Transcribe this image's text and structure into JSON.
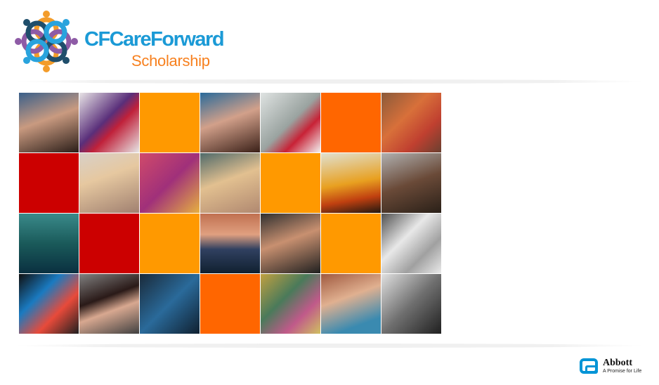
{
  "header": {
    "brand_line1": "CFCareForward",
    "brand_line2": "Scholarship"
  },
  "colors": {
    "brand_blue": "#1b9ad6",
    "brand_orange": "#f7801e",
    "tile_orange": "#ff9900",
    "tile_dark_orange": "#ff6600",
    "tile_red": "#cc0000"
  },
  "tiles": [
    {
      "kind": "photo",
      "subject": "student-portrait",
      "bg": "linear-gradient(160deg,#3a5f8a,#c99a80 45%,#2a1d18)"
    },
    {
      "kind": "art",
      "subject": "rose-painting",
      "bg": "linear-gradient(135deg,#e8e4e6,#5a2f7a 45%,#c0213a 60%,#e6e6e6)"
    },
    {
      "kind": "solid",
      "bg": "#ff9900"
    },
    {
      "kind": "photo",
      "subject": "student-portrait",
      "bg": "linear-gradient(160deg,#2a6a9a,#d2a08a 45%,#3a2018)"
    },
    {
      "kind": "art",
      "subject": "lighthouse-poem",
      "bg": "linear-gradient(135deg,#dfe3e2,#9aa3a0 50%,#c82236 70%,#f2f2f2)"
    },
    {
      "kind": "solid",
      "bg": "#ff6600"
    },
    {
      "kind": "art",
      "subject": "tree-painting",
      "bg": "linear-gradient(135deg,#8a5a3a,#d8703a 40%,#c04030 70%,#6a4030)"
    },
    {
      "kind": "solid",
      "bg": "#cc0000"
    },
    {
      "kind": "photo",
      "subject": "student-portrait",
      "bg": "linear-gradient(160deg,#d8d0c8,#e6c8a0 40%,#a08070)"
    },
    {
      "kind": "art",
      "subject": "collage-painting",
      "bg": "linear-gradient(135deg,#d04a6a,#a0307a 50%,#e6b040)"
    },
    {
      "kind": "photo",
      "subject": "student-portrait",
      "bg": "linear-gradient(160deg,#506a6a,#e2c090 45%,#b08870)"
    },
    {
      "kind": "solid",
      "bg": "#ff9900"
    },
    {
      "kind": "art",
      "subject": "sunset-silhouette",
      "bg": "linear-gradient(170deg,#e0e0d0,#e8a020 50%,#c04010 75%,#201810)"
    },
    {
      "kind": "photo",
      "subject": "student-portrait",
      "bg": "linear-gradient(160deg,#b0b0b0,#6a4a38 50%,#2a2018)"
    },
    {
      "kind": "art",
      "subject": "lake-painting",
      "bg": "linear-gradient(180deg,#3a8a8a,#1a5a5a 50%,#0a3040)"
    },
    {
      "kind": "solid",
      "bg": "#cc0000"
    },
    {
      "kind": "solid",
      "bg": "#ff9900"
    },
    {
      "kind": "art",
      "subject": "lighthouse-painting",
      "bg": "linear-gradient(180deg,#c07050,#e0a080 35%,#304060 60%,#102030)"
    },
    {
      "kind": "photo",
      "subject": "student-portrait",
      "bg": "linear-gradient(160deg,#303030,#c89070 45%,#202020)"
    },
    {
      "kind": "solid",
      "bg": "#ff9900"
    },
    {
      "kind": "art",
      "subject": "flower-sketch",
      "bg": "linear-gradient(135deg,#505050,#e8e8e8 40%,#a0a0a0 70%,#eaeaea)"
    },
    {
      "kind": "art",
      "subject": "flower-painting",
      "bg": "linear-gradient(135deg,#101010,#1a7ac0 35%,#e84a3a 65%,#202020)"
    },
    {
      "kind": "photo",
      "subject": "student-portrait",
      "bg": "linear-gradient(160deg,#808080,#2a1a18 40%,#d8a890 60%,#404040)"
    },
    {
      "kind": "art",
      "subject": "blue-painting",
      "bg": "linear-gradient(135deg,#1a2a3a,#2a6a9a 50%,#102030)"
    },
    {
      "kind": "solid",
      "bg": "#ff6600"
    },
    {
      "kind": "art",
      "subject": "doodle-art",
      "bg": "linear-gradient(135deg,#c0a040,#4a7a5a 40%,#c05a8a 70%,#d0c060)"
    },
    {
      "kind": "photo",
      "subject": "student-portrait",
      "bg": "linear-gradient(160deg,#a05a40,#e0b090 40%,#3a8ab0 80%)"
    },
    {
      "kind": "art",
      "subject": "lamp-sketch",
      "bg": "linear-gradient(135deg,#e0e0e0,#707070 50%,#202020)"
    }
  ],
  "footer": {
    "company": "Abbott",
    "tagline": "A Promise for Life"
  }
}
